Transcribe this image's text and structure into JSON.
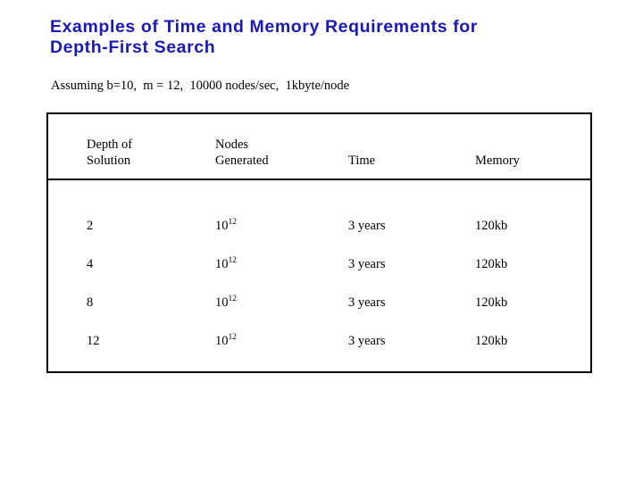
{
  "slide": {
    "title": "Examples of Time and Memory Requirements for\nDepth-First Search",
    "title_color": "#1a1ab4",
    "assumption": "Assuming b=10,  m = 12,  10000 nodes/sec,  1kbyte/node"
  },
  "table": {
    "headers": [
      {
        "line1": "Depth of",
        "line2": "Solution"
      },
      {
        "line1": "Nodes",
        "line2": "Generated"
      },
      {
        "line1": "",
        "line2": "Time"
      },
      {
        "line1": "",
        "line2": "Memory"
      }
    ],
    "rows": [
      {
        "depth": "2",
        "nodes_base": "10",
        "nodes_exp": "12",
        "time": "3 years",
        "memory": "120kb"
      },
      {
        "depth": "4",
        "nodes_base": "10",
        "nodes_exp": "12",
        "time": "3 years",
        "memory": "120kb"
      },
      {
        "depth": "8",
        "nodes_base": "10",
        "nodes_exp": "12",
        "time": "3 years",
        "memory": "120kb"
      },
      {
        "depth": "12",
        "nodes_base": "10",
        "nodes_exp": "12",
        "time": "3 years",
        "memory": "120kb"
      }
    ]
  }
}
